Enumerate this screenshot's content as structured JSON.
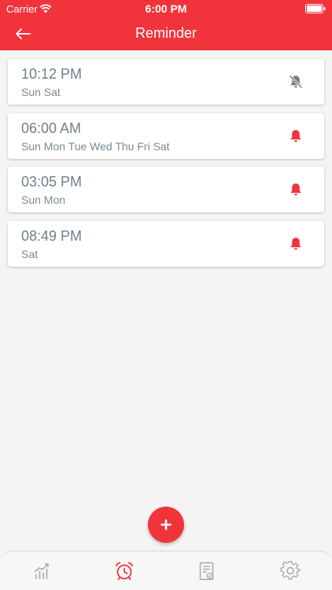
{
  "status_bar": {
    "carrier": "Carrier",
    "time": "6:00 PM"
  },
  "header": {
    "title": "Reminder",
    "back_icon": "arrow-left-icon"
  },
  "reminders": [
    {
      "time": "10:12 PM",
      "days": "Sun Sat",
      "enabled": false
    },
    {
      "time": "06:00 AM",
      "days": "Sun Mon Tue Wed Thu Fri Sat",
      "enabled": true
    },
    {
      "time": "03:05 PM",
      "days": "Sun Mon",
      "enabled": true
    },
    {
      "time": "08:49 PM",
      "days": "Sat",
      "enabled": true
    }
  ],
  "add_button_icon": "plus-icon",
  "tabs": [
    {
      "icon": "chart-icon",
      "active": false
    },
    {
      "icon": "alarm-clock-icon",
      "active": true
    },
    {
      "icon": "report-icon",
      "active": false
    },
    {
      "icon": "gear-icon",
      "active": false
    }
  ],
  "colors": {
    "accent": "#f1343c",
    "bell_off": "#7c7c7c",
    "tab_inactive": "#a7a7a7",
    "text_secondary": "#6f7f89"
  }
}
